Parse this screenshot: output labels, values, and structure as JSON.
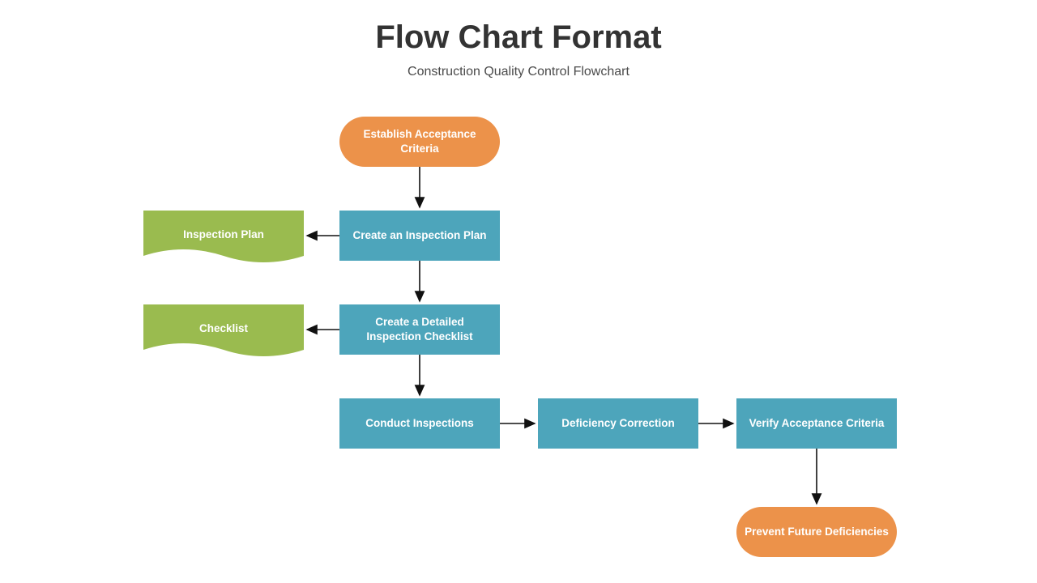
{
  "title": "Flow Chart Format",
  "subtitle": "Construction Quality Control Flowchart",
  "colors": {
    "orange": "#ec924a",
    "teal": "#4da5bb",
    "green": "#9abb4f",
    "text": "#333333"
  },
  "nodes": {
    "start": "Establish Acceptance Criteria",
    "createPlan": "Create an Inspection Plan",
    "docPlan": "Inspection Plan",
    "createChecklist": "Create a Detailed Inspection Checklist",
    "docChecklist": "Checklist",
    "conduct": "Conduct Inspections",
    "deficiency": "Deficiency Correction",
    "verify": "Verify Acceptance Criteria",
    "end": "Prevent Future Deficiencies"
  }
}
